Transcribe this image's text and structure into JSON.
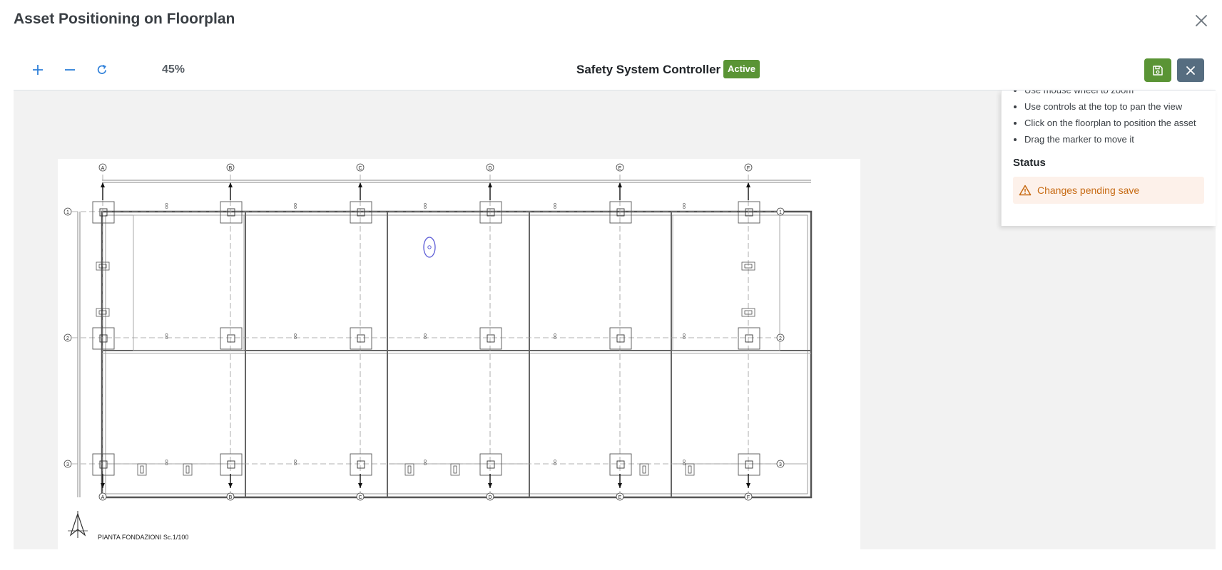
{
  "modal": {
    "title": "Asset Positioning on Floorplan"
  },
  "toolbar": {
    "zoom_level": "45%",
    "asset_title": "Safety System Controller",
    "status_badge": "Active"
  },
  "help": {
    "items": [
      "Use mouse wheel to zoom",
      "Use controls at the top to pan the view",
      "Click on the floorplan to position the asset",
      "Drag the marker to move it"
    ],
    "status_heading": "Status",
    "status_message": "Changes pending save"
  },
  "floorplan": {
    "title": "PIANTA FONDAZIONI Sc.1/100",
    "column_labels": [
      "A",
      "B",
      "C",
      "D",
      "E",
      "F"
    ],
    "row_labels": [
      "1",
      "2",
      "3"
    ]
  },
  "icons": {
    "zoom_in": "plus-icon",
    "zoom_out": "minus-icon",
    "reset": "refresh-icon",
    "save": "floppy-disk-icon",
    "cancel": "close-icon",
    "warning": "warning-triangle-icon",
    "marker": "location-pin-icon",
    "north": "north-arrow-icon"
  },
  "colors": {
    "primary_blue": "#2e7fd9",
    "success_green": "#5a9435",
    "secondary_slate": "#566d80",
    "warning_orange": "#c76a12",
    "warning_bg": "#fdf1ea",
    "marker_blue": "#5b5bd6"
  }
}
